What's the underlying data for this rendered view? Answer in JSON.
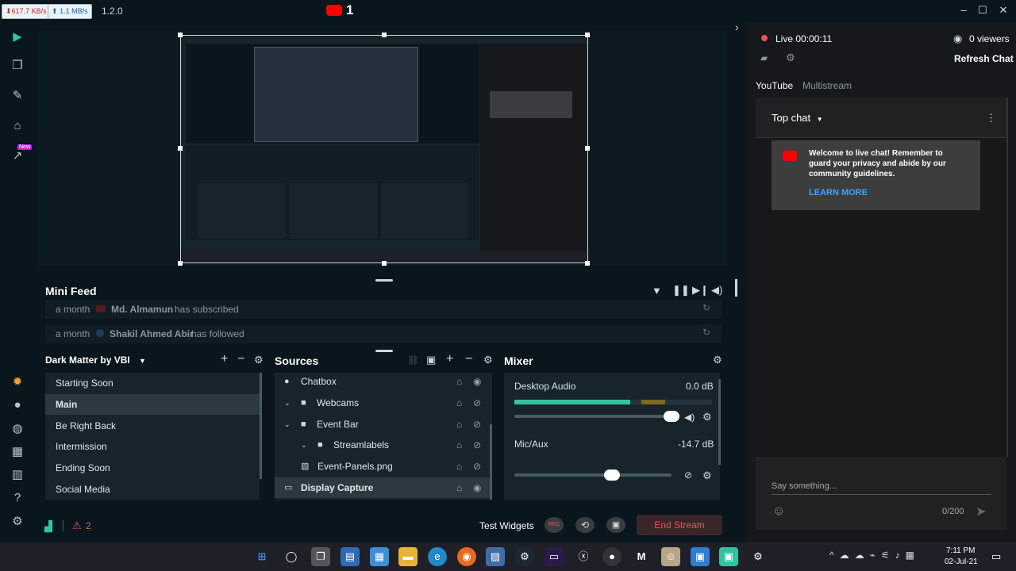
{
  "titlebar": {
    "download_speed": "617.7 KB/s",
    "upload_speed": "1.1 MB/s",
    "version": "1.2.0",
    "youtube_count": "1",
    "minimize": "–",
    "maximize": "☐",
    "close": "✕"
  },
  "mini_feed": {
    "title": "Mini Feed",
    "items": [
      {
        "time": "a month",
        "name": "Md. Almamun",
        "action": "has subscribed"
      },
      {
        "time": "a month",
        "name": "Shakil Ahmed Abir",
        "action": "has followed"
      }
    ]
  },
  "scenes": {
    "title": "Dark Matter by VBI",
    "items": [
      "Starting Soon",
      "Main",
      "Be Right Back",
      "Intermission",
      "Ending Soon",
      "Social Media"
    ],
    "selected_index": 1
  },
  "sources": {
    "title": "Sources",
    "items": [
      "Chatbox",
      "Webcams",
      "Event Bar",
      "Streamlabels",
      "Event-Panels.png",
      "Display Capture"
    ]
  },
  "mixer": {
    "title": "Mixer",
    "channels": [
      {
        "name": "Desktop Audio",
        "level": "0.0 dB",
        "slider": 0.93
      },
      {
        "name": "Mic/Aux",
        "level": "-14.7 dB",
        "slider": 0.6
      }
    ]
  },
  "footer": {
    "alert_count": "2",
    "test_widgets": "Test Widgets",
    "rec": "REC",
    "end_stream": "End Stream"
  },
  "chat": {
    "live_time": "Live 00:00:11",
    "viewers": "0 viewers",
    "refresh": "Refresh Chat",
    "tabs": [
      "YouTube",
      "Multistream"
    ],
    "top_chat": "Top chat",
    "welcome": "Welcome to live chat! Remember to guard your privacy and abide by our community guidelines.",
    "learn_more": "LEARN MORE",
    "placeholder": "Say something...",
    "counter": "0/200"
  },
  "nav": {
    "new_badge": "New"
  },
  "taskbar": {
    "time": "7:11 PM",
    "date": "02-Jul-21"
  },
  "colors": {
    "accent": "#31c3a2",
    "end_stream": "#ef5350",
    "youtube_red": "#ff0000",
    "learn_more": "#3ea6ff"
  }
}
